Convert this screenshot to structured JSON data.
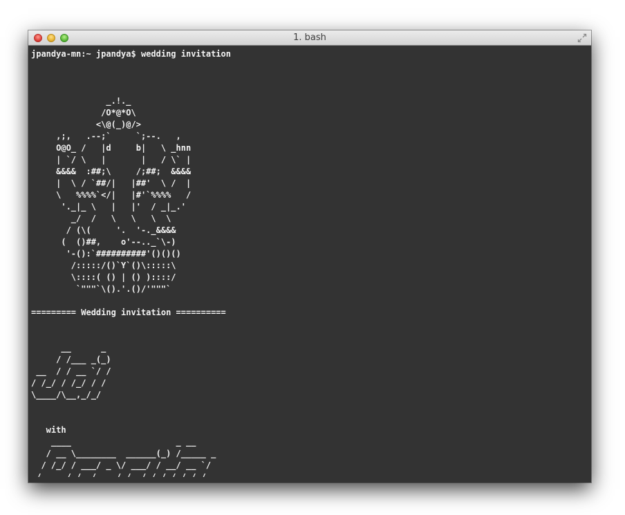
{
  "window": {
    "title": "1. bash"
  },
  "terminal": {
    "lines": [
      "jpandya-mn:~ jpandya$ wedding invitation",
      "",
      "",
      "",
      "               _.!._",
      "              /O*@*O\\",
      "             <\\@(_)@/>",
      "     ,;,   .--;`     `;--.   ,",
      "     O@O_ /   |d     b|   \\ _hnn",
      "     | `/ \\   |       |   / \\` |",
      "     &&&&  :##;\\     /;##;  &&&&",
      "     |  \\ / `##/|   |##'  \\ /  |",
      "     \\   %%%%`</|   |#'`%%%%   /",
      "      '._|_ \\   |   |'  / _|_.'",
      "        _/  /   \\   \\   \\  \\",
      "       / (\\(     '.  '-._&&&&",
      "      (  ()##,    o'--.._`\\-)",
      "       '-():`##########'()()()",
      "        /:::::/()`Y`()\\:::::\\",
      "        \\::::( () | () )::::/",
      "         `\"\"\"`\\().'.()/'\"\"\"`",
      "",
      "========= Wedding invitation ==========",
      "",
      "",
      "      __      _",
      "     / /___ _(_)",
      " __  / / __ `/ /",
      "/ /_/ / /_/ / /",
      "\\____/\\__,_/_/",
      "",
      "",
      "   with",
      "    ____                     _ __",
      "   / __ \\________  ______(_) /_____ _",
      "  / /_/ / ___/ _ \\/ ___/ / __/ __ `/",
      " / ____/ /  /  __/ /  / / /_/ /_/ /",
      "/_/   /_/   \\___/_/  /_/\\__/\\__,_/"
    ]
  },
  "icons": {
    "close": "close-button-icon",
    "minimize": "minimize-button-icon",
    "zoom": "zoom-button-icon",
    "fullscreen": "fullscreen-arrows-icon"
  }
}
